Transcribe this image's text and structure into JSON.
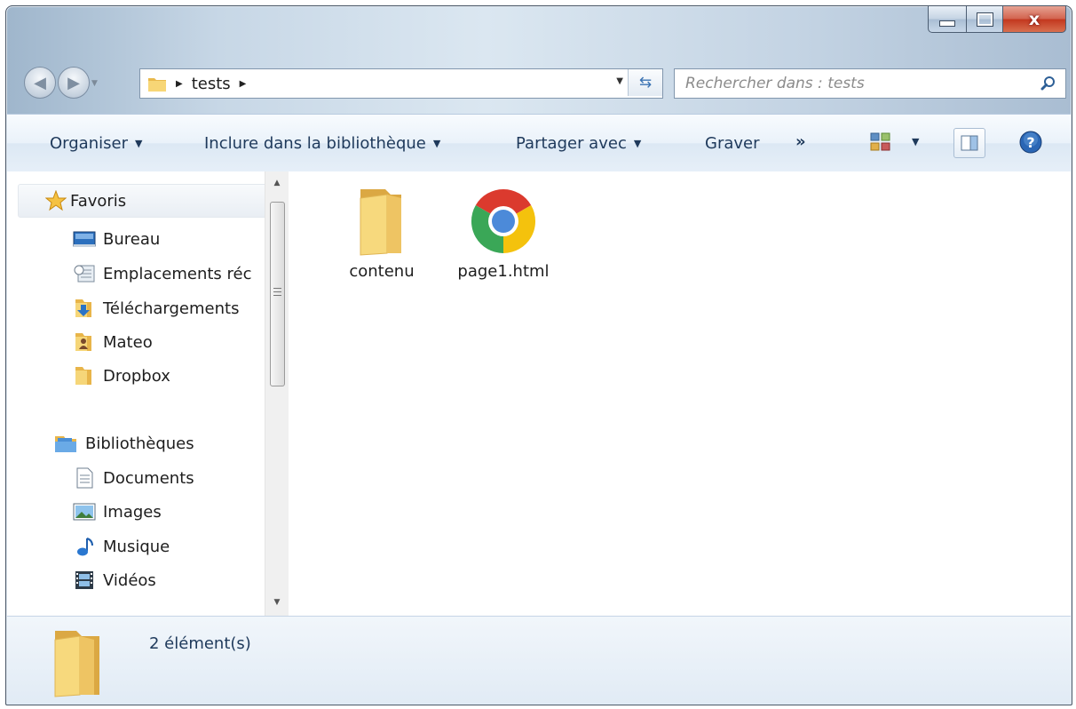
{
  "window": {
    "caption_buttons": {
      "minimize": "minimize-icon",
      "maximize": "maximize-icon",
      "close": "x"
    }
  },
  "navigation": {
    "back_icon": "back-arrow-icon",
    "forward_icon": "forward-arrow-icon",
    "address": {
      "crumbs": [
        "tests"
      ]
    },
    "search": {
      "placeholder": "Rechercher dans : tests"
    }
  },
  "toolbar": {
    "organize": "Organiser",
    "include": "Inclure dans la bibliothèque",
    "share": "Partager avec",
    "burn": "Graver",
    "more": "»"
  },
  "sidebar": {
    "favorites": {
      "label": "Favoris",
      "items": [
        {
          "label": "Bureau",
          "icon": "desktop-icon"
        },
        {
          "label": "Emplacements réc",
          "icon": "recent-places-icon"
        },
        {
          "label": "Téléchargements",
          "icon": "downloads-folder-icon"
        },
        {
          "label": "Mateo",
          "icon": "user-folder-icon"
        },
        {
          "label": "Dropbox",
          "icon": "folder-icon"
        }
      ]
    },
    "libraries": {
      "label": "Bibliothèques",
      "items": [
        {
          "label": "Documents",
          "icon": "documents-icon"
        },
        {
          "label": "Images",
          "icon": "images-icon"
        },
        {
          "label": "Musique",
          "icon": "music-icon"
        },
        {
          "label": "Vidéos",
          "icon": "videos-icon"
        }
      ]
    }
  },
  "files": [
    {
      "name": "contenu",
      "icon": "folder-icon"
    },
    {
      "name": "page1.html",
      "icon": "chrome-icon"
    }
  ],
  "status": {
    "count": "2 élément(s)"
  },
  "colors": {
    "frame": "#c7d7e6",
    "toolbar": "#e6eff8",
    "close_button": "#c2361e",
    "folder": "#f1c659",
    "link_text": "#1e395b"
  }
}
